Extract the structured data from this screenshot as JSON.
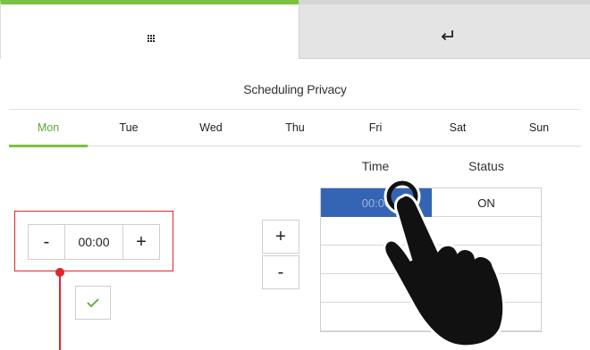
{
  "header": {
    "home_tab_icon": "grid-icon",
    "back_tab_icon": "return-arrow-icon",
    "accent_color": "#7cc242"
  },
  "page": {
    "subtitle": "Scheduling Privacy"
  },
  "days": {
    "items": [
      "Mon",
      "Tue",
      "Wed",
      "Thu",
      "Fri",
      "Sat",
      "Sun"
    ],
    "selected": "Mon"
  },
  "time_control": {
    "minus_label": "-",
    "value": "00:00",
    "plus_label": "+",
    "highlight_color": "#e0262b"
  },
  "confirm": {
    "icon": "check-icon"
  },
  "row_buttons": {
    "plus_label": "+",
    "minus_label": "-"
  },
  "schedule_table": {
    "headers": {
      "time": "Time",
      "status": "Status"
    },
    "rows": [
      {
        "time": "00:00",
        "status": "ON",
        "selected": true
      },
      {
        "time": "",
        "status": ""
      },
      {
        "time": "",
        "status": ""
      },
      {
        "time": "",
        "status": ""
      },
      {
        "time": "",
        "status": ""
      }
    ],
    "selected_color": "#3465b4"
  },
  "overlay": {
    "icon": "tap-hand-icon"
  }
}
